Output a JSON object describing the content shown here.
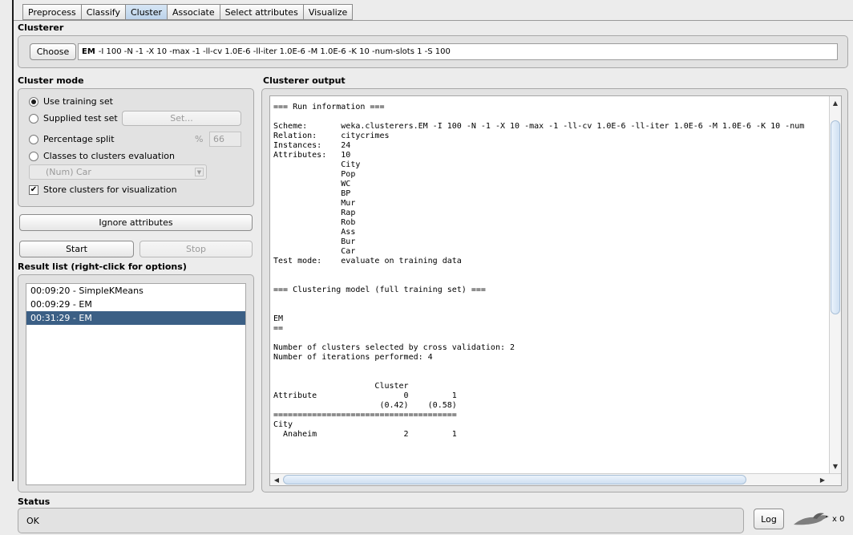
{
  "tabs": [
    {
      "label": "Preprocess"
    },
    {
      "label": "Classify"
    },
    {
      "label": "Cluster"
    },
    {
      "label": "Associate"
    },
    {
      "label": "Select attributes"
    },
    {
      "label": "Visualize"
    }
  ],
  "clusterer": {
    "title": "Clusterer",
    "choose_label": "Choose",
    "algorithm": "EM",
    "options": "-I 100 -N -1 -X 10 -max -1 -ll-cv 1.0E-6 -ll-iter 1.0E-6 -M 1.0E-6 -K 10 -num-slots 1 -S 100"
  },
  "cluster_mode": {
    "title": "Cluster mode",
    "use_training": "Use training set",
    "supplied_test": "Supplied test set",
    "set_label": "Set...",
    "percentage_split": "Percentage split",
    "percent_symbol": "%",
    "percent_value": "66",
    "classes_eval": "Classes to clusters evaluation",
    "class_attr": "(Num) Car",
    "store_clusters": "Store clusters for visualization"
  },
  "ignore_label": "Ignore attributes",
  "start_label": "Start",
  "stop_label": "Stop",
  "result_list": {
    "title": "Result list (right-click for options)",
    "items": [
      "00:09:20 - SimpleKMeans",
      "00:09:29 - EM",
      "00:31:29 - EM"
    ]
  },
  "output": {
    "title": "Clusterer output",
    "text": "=== Run information ===\n\nScheme:       weka.clusterers.EM -I 100 -N -1 -X 10 -max -1 -ll-cv 1.0E-6 -ll-iter 1.0E-6 -M 1.0E-6 -K 10 -num\nRelation:     citycrimes\nInstances:    24\nAttributes:   10\n              City\n              Pop\n              WC\n              BP\n              Mur\n              Rap\n              Rob\n              Ass\n              Bur\n              Car\nTest mode:    evaluate on training data\n\n\n=== Clustering model (full training set) ===\n\n\nEM\n==\n\nNumber of clusters selected by cross validation: 2\nNumber of iterations performed: 4\n\n\n                     Cluster\nAttribute                  0         1\n                      (0.42)    (0.58)\n======================================\nCity\n  Anaheim                  2         1"
  },
  "status": {
    "title": "Status",
    "text": "OK",
    "log_label": "Log",
    "count": "x 0"
  }
}
